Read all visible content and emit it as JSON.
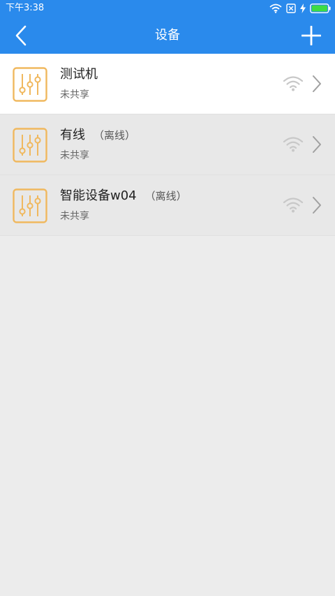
{
  "status_bar": {
    "time": "下午3:38",
    "icons": [
      "wifi-icon",
      "sim-x-icon",
      "charging-bolt-icon",
      "battery-icon"
    ],
    "battery_color": "#3ddc44"
  },
  "app_bar": {
    "title": "设备",
    "background_color": "#2a8aec",
    "left_icon": "back-chevron-icon",
    "right_icon": "plus-icon"
  },
  "devices": [
    {
      "name": "测试机",
      "status": "",
      "share": "未共享",
      "online": true,
      "icon": "sliders-icon"
    },
    {
      "name": "有线",
      "status": "（离线）",
      "share": "未共享",
      "online": false,
      "icon": "sliders-icon"
    },
    {
      "name": "智能设备w04",
      "status": "（离线）",
      "share": "未共享",
      "online": false,
      "icon": "sliders-icon"
    }
  ],
  "colors": {
    "accent": "#2a8aec",
    "device_icon": "#f0b85e",
    "signal_icon": "#c8c8c8",
    "chevron": "#a0a0a0"
  }
}
